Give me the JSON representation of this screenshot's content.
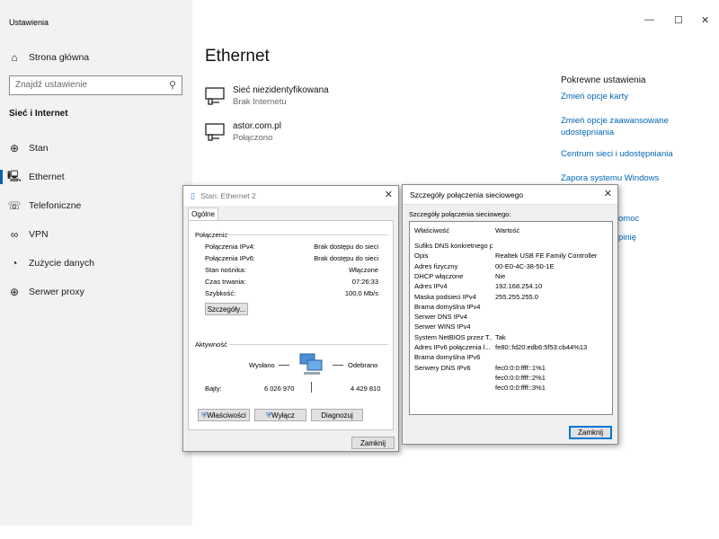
{
  "window": {
    "title": "Ustawienia"
  },
  "sidebar": {
    "home": "Strona główna",
    "search_placeholder": "Znajdź ustawienie",
    "section": "Sieć i Internet",
    "items": [
      {
        "label": "Stan",
        "icon": "globe-icon"
      },
      {
        "label": "Ethernet",
        "icon": "ethernet-icon"
      },
      {
        "label": "Telefoniczne",
        "icon": "dialup-icon"
      },
      {
        "label": "VPN",
        "icon": "vpn-icon"
      },
      {
        "label": "Zużycie danych",
        "icon": "data-usage-icon"
      },
      {
        "label": "Serwer proxy",
        "icon": "globe-icon"
      }
    ]
  },
  "main": {
    "title": "Ethernet",
    "networks": [
      {
        "name": "Sieć niezidentyfikowana",
        "status": "Brak Internetu"
      },
      {
        "name": "astor.com.pl",
        "status": "Połączono"
      }
    ]
  },
  "related": {
    "header": "Pokrewne ustawienia",
    "links": [
      "Zmień opcje karty",
      "Zmień opcje zaawansowane udostępniania",
      "Centrum sieci i udostępniania",
      "Zapora systemu Windows"
    ],
    "partial_links": [
      "omoc",
      "pinię"
    ]
  },
  "status_dialog": {
    "title": "Stan: Ethernet 2",
    "tab": "Ogólne",
    "connection_header": "Połączenie",
    "rows": [
      {
        "label": "Połączenia IPv4:",
        "value": "Brak dostępu do sieci"
      },
      {
        "label": "Połączenia IPv6:",
        "value": "Brak dostępu do sieci"
      },
      {
        "label": "Stan nośnika:",
        "value": "Włączone"
      },
      {
        "label": "Czas trwania:",
        "value": "07:26:33"
      },
      {
        "label": "Szybkość:",
        "value": "100,0 Mb/s"
      }
    ],
    "details_button": "Szczegóły...",
    "activity_header": "Aktywność",
    "sent_label": "Wysłano",
    "received_label": "Odebrano",
    "bytes_label": "Bajty:",
    "bytes_sent": "6 026 970",
    "bytes_received": "4 429 810",
    "properties_button": "Właściwości",
    "disable_button": "Wyłącz",
    "diagnose_button": "Diagnozuj",
    "close_button": "Zamknij"
  },
  "details_dialog": {
    "title": "Szczegóły połączenia sieciowego",
    "label": "Szczegóły połączenia sieciowego:",
    "col_property": "Właściwość",
    "col_value": "Wartość",
    "rows": [
      {
        "k": "Sufiks DNS konkretnego p...",
        "v": ""
      },
      {
        "k": "Opis",
        "v": "Realtek USB FE Family Controller"
      },
      {
        "k": "Adres fizyczny",
        "v": "00-E0-4C-38-50-1E"
      },
      {
        "k": "DHCP włączone",
        "v": "Nie"
      },
      {
        "k": "Adres IPv4",
        "v": "192.168.254.10"
      },
      {
        "k": "Maska podsieci IPv4",
        "v": "255.255.255.0"
      },
      {
        "k": "Brama domyślna IPv4",
        "v": ""
      },
      {
        "k": "Serwer DNS IPv4",
        "v": ""
      },
      {
        "k": "Serwer WINS IPv4",
        "v": ""
      },
      {
        "k": "System NetBIOS przez T...",
        "v": "Tak"
      },
      {
        "k": "Adres IPv6 połączenia l...",
        "v": "fe80::fd20:edb6:5f53:cb44%13"
      },
      {
        "k": "Brama domyślna IPv6",
        "v": ""
      },
      {
        "k": "Serwery DNS IPv6",
        "v": "fec0:0:0:ffff::1%1"
      },
      {
        "k": "",
        "v": "fec0:0:0:ffff::2%1"
      },
      {
        "k": "",
        "v": "fec0:0:0:ffff::3%1"
      }
    ],
    "close_button": "Zamknij"
  }
}
